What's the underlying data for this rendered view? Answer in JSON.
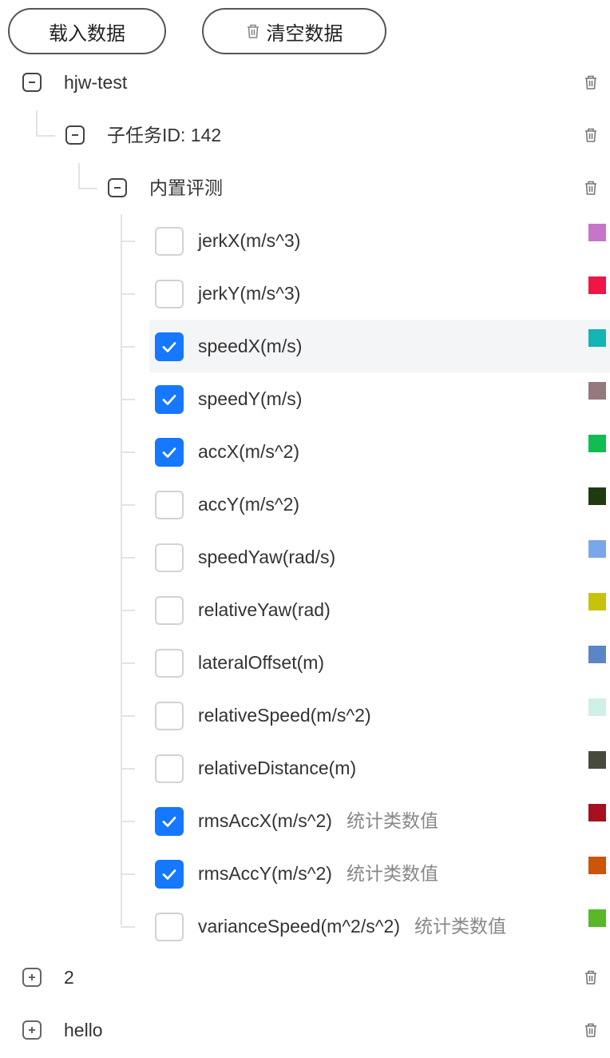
{
  "toolbar": {
    "load_label": "载入数据",
    "clear_label": "清空数据"
  },
  "tree": {
    "root1": {
      "label": "hjw-test",
      "expanded": true
    },
    "sub": {
      "label": "子任务ID: 142",
      "expanded": true
    },
    "group": {
      "label": "内置评测",
      "expanded": true
    },
    "items": [
      {
        "label": "jerkX(m/s^3)",
        "checked": false,
        "color": "#c774c9",
        "tag": ""
      },
      {
        "label": "jerkY(m/s^3)",
        "checked": false,
        "color": "#ee1547",
        "tag": ""
      },
      {
        "label": "speedX(m/s)",
        "checked": true,
        "color": "#13b3b6",
        "tag": ""
      },
      {
        "label": "speedY(m/s)",
        "checked": true,
        "color": "#94797f",
        "tag": ""
      },
      {
        "label": "accX(m/s^2)",
        "checked": true,
        "color": "#0fbd52",
        "tag": ""
      },
      {
        "label": "accY(m/s^2)",
        "checked": false,
        "color": "#1f3a12",
        "tag": ""
      },
      {
        "label": "speedYaw(rad/s)",
        "checked": false,
        "color": "#7aa7ea",
        "tag": ""
      },
      {
        "label": "relativeYaw(rad)",
        "checked": false,
        "color": "#c9c20d",
        "tag": ""
      },
      {
        "label": "lateralOffset(m)",
        "checked": false,
        "color": "#5b86c6",
        "tag": ""
      },
      {
        "label": "relativeSpeed(m/s^2)",
        "checked": false,
        "color": "#cff0e6",
        "tag": ""
      },
      {
        "label": "relativeDistance(m)",
        "checked": false,
        "color": "#474a3b",
        "tag": ""
      },
      {
        "label": "rmsAccX(m/s^2)",
        "checked": true,
        "color": "#a7101f",
        "tag": "统计类数值"
      },
      {
        "label": "rmsAccY(m/s^2)",
        "checked": true,
        "color": "#cd5508",
        "tag": "统计类数值"
      },
      {
        "label": "varianceSpeed(m^2/s^2)",
        "checked": false,
        "color": "#58b828",
        "tag": "统计类数值"
      }
    ],
    "root2": {
      "label": "2",
      "expanded": false
    },
    "root3": {
      "label": "hello",
      "expanded": false
    }
  }
}
